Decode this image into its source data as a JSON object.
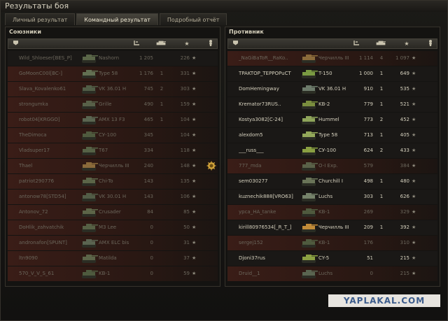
{
  "window": {
    "title": "Результаты боя"
  },
  "tabs": [
    {
      "label": "Личный результат",
      "active": false
    },
    {
      "label": "Командный результат",
      "active": true
    },
    {
      "label": "Подробный отчёт",
      "active": false
    }
  ],
  "allies": {
    "title": "Союзники",
    "rows": [
      {
        "player": "Wild_Shloeser[BES_P]",
        "vehicle": "Nashorn",
        "damage": "1 205",
        "kills": "",
        "xp": "226",
        "alive": false,
        "hl": false,
        "tank_color": "#5a6648"
      },
      {
        "player": "GoMoonC00l[BC-]",
        "vehicle": "Type 58",
        "damage": "1 176",
        "kills": "1",
        "xp": "331",
        "alive": false,
        "hl": true,
        "tank_color": "#627052"
      },
      {
        "player": "Slava_Kovalenko61",
        "vehicle": "VK 36.01 H",
        "damage": "745",
        "kills": "2",
        "xp": "303",
        "alive": false,
        "hl": true,
        "tank_color": "#515d46"
      },
      {
        "player": "strongumka",
        "vehicle": "Grille",
        "damage": "490",
        "kills": "1",
        "xp": "159",
        "alive": false,
        "hl": true,
        "tank_color": "#586048"
      },
      {
        "player": "robot04[KRGGO]",
        "vehicle": "AMX 13 F3",
        "damage": "465",
        "kills": "1",
        "xp": "104",
        "alive": false,
        "hl": true,
        "tank_color": "#5a6550"
      },
      {
        "player": "TheDimoca",
        "vehicle": "СУ-100",
        "damage": "345",
        "kills": "",
        "xp": "104",
        "alive": false,
        "hl": true,
        "tank_color": "#4f5a3e"
      },
      {
        "player": "Vladsuper17",
        "vehicle": "T67",
        "damage": "334",
        "kills": "",
        "xp": "118",
        "alive": false,
        "hl": true,
        "tank_color": "#566246"
      },
      {
        "player": "Thael",
        "vehicle": "Черчилль III",
        "damage": "240",
        "kills": "",
        "xp": "148",
        "alive": false,
        "hl": true,
        "tank_color": "#8a6a3a",
        "medal": true
      },
      {
        "player": "patriot290776",
        "vehicle": "Chi-To",
        "damage": "143",
        "kills": "",
        "xp": "135",
        "alive": false,
        "hl": true,
        "tank_color": "#5b6548"
      },
      {
        "player": "antonow78[STD54]",
        "vehicle": "VK 30.01 H",
        "damage": "143",
        "kills": "",
        "xp": "106",
        "alive": false,
        "hl": true,
        "tank_color": "#525c46"
      },
      {
        "player": "Antonov_72",
        "vehicle": "Crusader",
        "damage": "84",
        "kills": "",
        "xp": "85",
        "alive": false,
        "hl": true,
        "tank_color": "#5d6548"
      },
      {
        "player": "DoHlik_zahvatchik",
        "vehicle": "M3 Lee",
        "damage": "0",
        "kills": "",
        "xp": "50",
        "alive": false,
        "hl": true,
        "tank_color": "#566044"
      },
      {
        "player": "andronafon[SPUNT]",
        "vehicle": "AMX ELC bis",
        "damage": "0",
        "kills": "",
        "xp": "31",
        "alive": false,
        "hl": true,
        "tank_color": "#5a6350"
      },
      {
        "player": "ltn9090",
        "vehicle": "Matilda",
        "damage": "0",
        "kills": "",
        "xp": "37",
        "alive": false,
        "hl": true,
        "tank_color": "#5c6448"
      },
      {
        "player": "570_V_V_S_61",
        "vehicle": "KB-1",
        "damage": "0",
        "kills": "",
        "xp": "59",
        "alive": false,
        "hl": true,
        "tank_color": "#4e5a3e"
      }
    ]
  },
  "enemies": {
    "title": "Противник",
    "rows": [
      {
        "player": "_NaGiBaToR__RaKo..",
        "vehicle": "Черчилль III",
        "damage": "1 114",
        "kills": "4",
        "xp": "1 097",
        "alive": false,
        "hl": true,
        "tank_color": "#8a6a3a"
      },
      {
        "player": "TPAKTOP_TEPPOPuCT",
        "vehicle": "T-150",
        "damage": "1 000",
        "kills": "1",
        "xp": "649",
        "alive": true,
        "hl": false,
        "tank_color": "#7a9a42"
      },
      {
        "player": "DomHemingway",
        "vehicle": "VK 36.01 H",
        "damage": "910",
        "kills": "1",
        "xp": "535",
        "alive": true,
        "hl": false,
        "tank_color": "#6c7a6a"
      },
      {
        "player": "Kremator73RUS..",
        "vehicle": "KB-2",
        "damage": "779",
        "kills": "1",
        "xp": "521",
        "alive": true,
        "hl": false,
        "tank_color": "#7a8e3e"
      },
      {
        "player": "Kostya3082[C-24]",
        "vehicle": "Hummel",
        "damage": "773",
        "kills": "2",
        "xp": "452",
        "alive": true,
        "hl": false,
        "tank_color": "#8ea45a"
      },
      {
        "player": "alexdom5",
        "vehicle": "Type 58",
        "damage": "713",
        "kills": "1",
        "xp": "405",
        "alive": true,
        "hl": false,
        "tank_color": "#93a85a"
      },
      {
        "player": "___russ___",
        "vehicle": "СУ-100",
        "damage": "624",
        "kills": "2",
        "xp": "433",
        "alive": true,
        "hl": false,
        "tank_color": "#8aa042"
      },
      {
        "player": "777_mda",
        "vehicle": "O-I Exp.",
        "damage": "579",
        "kills": "",
        "xp": "384",
        "alive": false,
        "hl": true,
        "tank_color": "#5a6148"
      },
      {
        "player": "sem030277",
        "vehicle": "Churchill I",
        "damage": "498",
        "kills": "1",
        "xp": "480",
        "alive": true,
        "hl": false,
        "tank_color": "#6a7458"
      },
      {
        "player": "kuznechik888[VRO63]",
        "vehicle": "Luchs",
        "damage": "303",
        "kills": "1",
        "xp": "626",
        "alive": true,
        "hl": false,
        "tank_color": "#75826a"
      },
      {
        "player": "ypca_HA_tanke",
        "vehicle": "KB-1",
        "damage": "269",
        "kills": "",
        "xp": "329",
        "alive": false,
        "hl": true,
        "tank_color": "#4f5a3e"
      },
      {
        "player": "kirill80976534[_R_T_]",
        "vehicle": "Черчилль III",
        "damage": "209",
        "kills": "1",
        "xp": "392",
        "alive": true,
        "hl": false,
        "tank_color": "#c08a38"
      },
      {
        "player": "sergej152",
        "vehicle": "KB-1",
        "damage": "176",
        "kills": "",
        "xp": "310",
        "alive": false,
        "hl": true,
        "tank_color": "#4f5a3e"
      },
      {
        "player": "Djoni37rus",
        "vehicle": "CY-5",
        "damage": "51",
        "kills": "",
        "xp": "215",
        "alive": true,
        "hl": false,
        "tank_color": "#8aa042"
      },
      {
        "player": "Druid__1",
        "vehicle": "Luchs",
        "damage": "0",
        "kills": "",
        "xp": "215",
        "alive": false,
        "hl": true,
        "tank_color": "#5a6550"
      }
    ]
  },
  "footer": {
    "stamp": "YAPLAKAL.COM"
  },
  "icons": {
    "column_player": "tank-player-icon",
    "column_vehicle": "tank-type-icon",
    "column_damage": "damage-icon",
    "column_kills": "kills-icon",
    "column_xp": "experience-star-icon",
    "column_medal": "medal-icon"
  },
  "colors": {
    "accent": "#3a1d17",
    "text_alive": "#d5d0bd",
    "text_dead": "#6b665b",
    "medal": "#d0a23a"
  }
}
